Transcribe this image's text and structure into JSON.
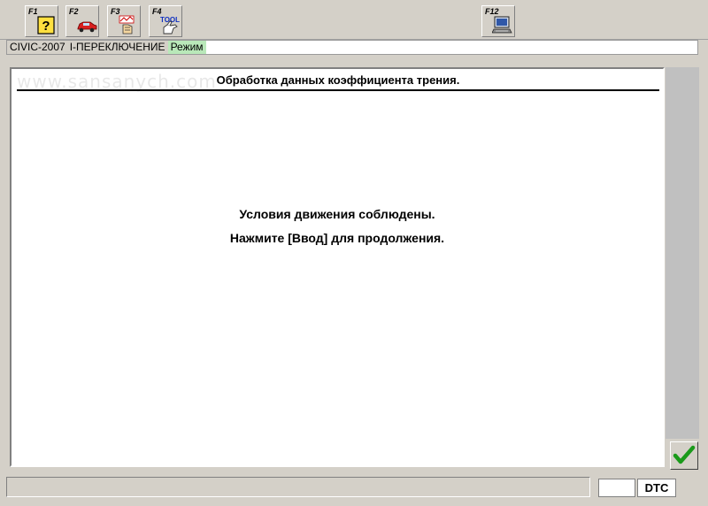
{
  "toolbar": {
    "buttons": [
      {
        "key": "F1",
        "icon": "help-icon"
      },
      {
        "key": "F2",
        "icon": "car-icon"
      },
      {
        "key": "F3",
        "icon": "data-icon"
      },
      {
        "key": "F4",
        "icon": "tool-icon",
        "icon_text": "TOOL"
      },
      {
        "key": "F12",
        "icon": "computer-icon"
      }
    ]
  },
  "status": {
    "model": "CIVIC-2007",
    "function": "I-ПЕРЕКЛЮЧЕНИЕ",
    "mode": "Режим"
  },
  "watermark": "www.sansanych.com",
  "panel": {
    "title": "Обработка данных коэффициента трения.",
    "message_line1": "Условия движения соблюдены.",
    "message_line2": "Нажмите [Ввод] для продолжения."
  },
  "bottom": {
    "dtc_label": "DTC"
  },
  "colors": {
    "background": "#d4d0c8",
    "mode_highlight": "#b9e8b9",
    "ok_check": "#1a9a1a"
  }
}
